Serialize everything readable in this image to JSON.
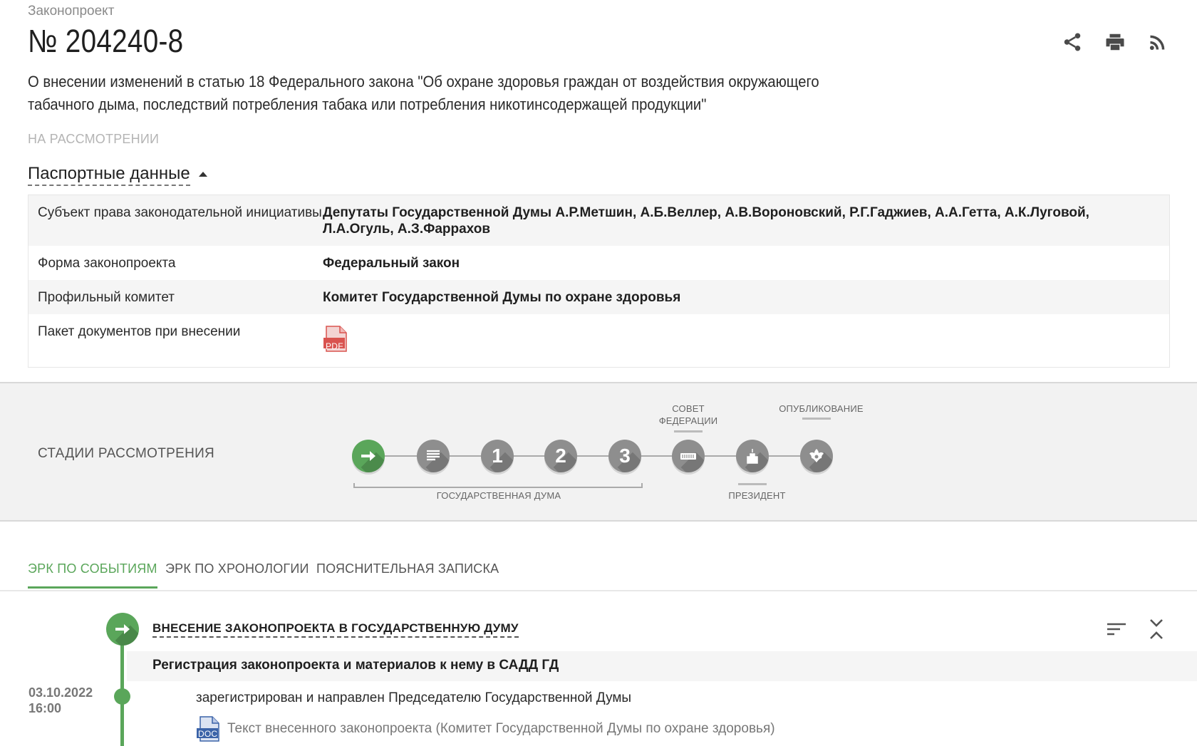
{
  "header": {
    "crumb": "Законопроект",
    "bill_number": "№ 204240-8",
    "description": "О внесении изменений в статью 18 Федерального закона \"Об охране здоровья граждан от воздействия окружающего табачного дыма, последствий потребления табака или потребления никотинсодержащей продукции\"",
    "status": "НА РАССМОТРЕНИИ",
    "icons": [
      "share-icon",
      "print-icon",
      "rss-icon"
    ]
  },
  "passport": {
    "toggle_label": "Паспортные данные",
    "rows": [
      {
        "key": "Субъект права законодательной инициативы",
        "value": "Депутаты Государственной Думы А.Р.Метшин, А.Б.Веллер, А.В.Вороновский, Р.Г.Гаджиев, А.А.Гетта, А.К.Луговой, Л.А.Огуль, А.З.Фаррахов"
      },
      {
        "key": "Форма законопроекта",
        "value": "Федеральный закон"
      },
      {
        "key": "Профильный комитет",
        "value": "Комитет Государственной Думы по охране здоровья"
      },
      {
        "key": "Пакет документов при внесении",
        "value": ""
      }
    ],
    "pdf_label": "PDF"
  },
  "stages": {
    "title": "СТАДИИ РАССМОТРЕНИЯ",
    "items": [
      {
        "id": "introduction",
        "glyph": "➜",
        "active": true
      },
      {
        "id": "preliminary",
        "glyph": "≣",
        "active": false
      },
      {
        "id": "reading-1",
        "glyph": "1",
        "active": false
      },
      {
        "id": "reading-2",
        "glyph": "2",
        "active": false
      },
      {
        "id": "reading-3",
        "glyph": "3",
        "active": false
      },
      {
        "id": "federation-council",
        "glyph": "▦",
        "active": false
      },
      {
        "id": "president",
        "glyph": "⌂",
        "active": false
      },
      {
        "id": "publication",
        "glyph": "✾",
        "active": false
      }
    ],
    "label_council": "СОВЕТ ФЕДЕРАЦИИ",
    "label_publication": "ОПУБЛИКОВАНИЕ",
    "label_duma": "ГОСУДАРСТВЕННАЯ ДУМА",
    "label_president": "ПРЕЗИДЕНТ"
  },
  "tabs": [
    {
      "label": "ЭРК ПО СОБЫТИЯМ",
      "active": true
    },
    {
      "label": "ЭРК ПО ХРОНОЛОГИИ",
      "active": false
    },
    {
      "label": "ПОЯСНИТЕЛЬНАЯ ЗАПИСКА",
      "active": false
    }
  ],
  "timeline": {
    "event_title": "ВНЕСЕНИЕ ЗАКОНОПРОЕКТА В ГОСУДАРСТВЕННУЮ ДУМУ",
    "sub_title": "Регистрация законопроекта и материалов к нему в САДД ГД",
    "date": "03.10.2022",
    "time": "16:00",
    "action": "зарегистрирован и направлен Председателю Государственной Думы",
    "doc_label": "DOC",
    "doc_text": "Текст внесенного законопроекта (Комитет Государственной Думы по охране здоровья)"
  },
  "colors": {
    "accent": "#5aa65a",
    "stage_inactive": "#8e8e8e",
    "pdf_red": "#d9534f",
    "doc_blue": "#3b63a8"
  }
}
